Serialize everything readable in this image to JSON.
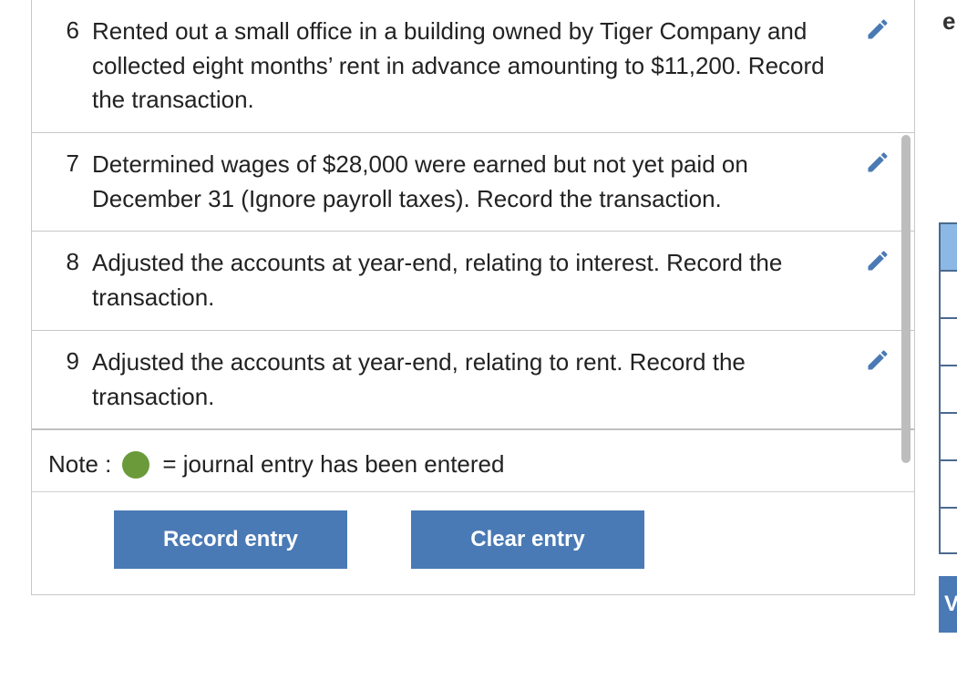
{
  "rows": [
    {
      "num": "6",
      "text": "Rented out a small office in a building owned by Tiger Company and collected eight months’ rent in advance amounting to $11,200. Record the transaction."
    },
    {
      "num": "7",
      "text": "Determined wages of $28,000 were earned but not yet paid on December 31 (Ignore payroll taxes). Record the transaction."
    },
    {
      "num": "8",
      "text": "Adjusted the accounts at year-end, relating to interest. Record the transaction."
    },
    {
      "num": "9",
      "text": "Adjusted the accounts at year-end, relating to rent. Record the transaction."
    }
  ],
  "note": {
    "label": "Note :",
    "legend": "= journal entry has been entered"
  },
  "buttons": {
    "record": "Record entry",
    "clear": "Clear entry",
    "view_partial": "V"
  },
  "rightcol": {
    "frag_top": "e"
  },
  "colors": {
    "accent": "#4a7ab5",
    "dot": "#6a9a3a"
  }
}
